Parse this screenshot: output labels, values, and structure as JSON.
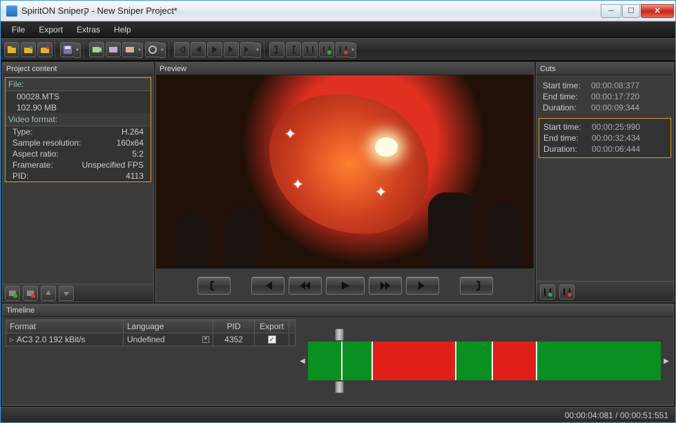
{
  "window": {
    "title": "SpiritON Sniperק - New Sniper Project*"
  },
  "menubar": [
    "File",
    "Export",
    "Extras",
    "Help"
  ],
  "panels": {
    "project": "Project content",
    "preview": "Preview",
    "cuts": "Cuts",
    "timeline": "Timeline"
  },
  "project": {
    "file_sect": "File:",
    "filename": "00028.MTS",
    "filesize": "102.90 MB",
    "vf_sect": "Video format:",
    "rows": {
      "type_k": "Type:",
      "type_v": "H.264",
      "res_k": "Sample resolution:",
      "res_v": "160x64",
      "ar_k": "Aspect ratio:",
      "ar_v": "5:2",
      "fr_k": "Framerate:",
      "fr_v": "Unspecified FPS",
      "pid_k": "PID:",
      "pid_v": "4113"
    }
  },
  "cuts": [
    {
      "start_k": "Start time:",
      "start_v": "00:00:08:377",
      "end_k": "End time:",
      "end_v": "00:00:17:720",
      "dur_k": "Duration:",
      "dur_v": "00:00:09:344",
      "selected": false
    },
    {
      "start_k": "Start time:",
      "start_v": "00:00:25:990",
      "end_k": "End time:",
      "end_v": "00:00:32:434",
      "dur_k": "Duration:",
      "dur_v": "00:00:06:444",
      "selected": true
    }
  ],
  "timeline": {
    "headers": {
      "fmt": "Format",
      "lang": "Language",
      "pid": "PID",
      "exp": "Export"
    },
    "row": {
      "fmt": "AC3 2.0 192 kBit/s",
      "lang": "Undefined",
      "pid": "4352",
      "exp": true
    },
    "cuts_pct": [
      {
        "l": 18,
        "w": 24
      },
      {
        "l": 52,
        "w": 13
      }
    ]
  },
  "status": {
    "times": "00:00:04:081 / 00:00:51:551"
  }
}
